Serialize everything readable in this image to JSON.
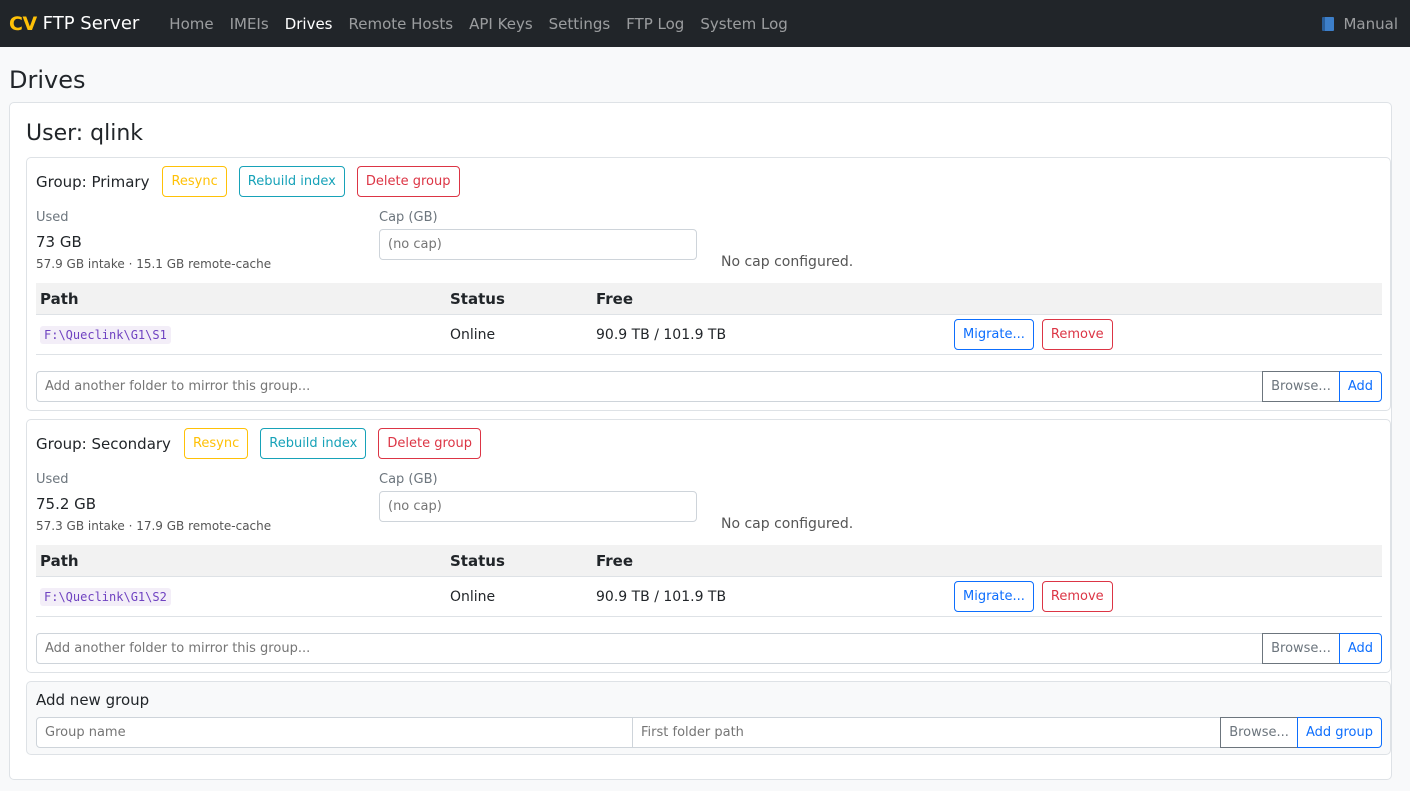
{
  "navbar": {
    "logo": "CV",
    "brand": "FTP Server",
    "links": [
      "Home",
      "IMEIs",
      "Drives",
      "Remote Hosts",
      "API Keys",
      "Settings",
      "FTP Log",
      "System Log"
    ],
    "active": "Drives",
    "manual": "Manual"
  },
  "page": {
    "title": "Drives"
  },
  "user": {
    "title": "User: qlink"
  },
  "groups": [
    {
      "title": "Group: Primary",
      "resync": "Resync",
      "rebuild": "Rebuild index",
      "delete": "Delete group",
      "used_label": "Used",
      "used_value": "73 GB",
      "used_detail": "57.9 GB intake · 15.1 GB remote-cache",
      "cap_label": "Cap (GB)",
      "cap_placeholder": "(no cap)",
      "cap_note": "No cap configured.",
      "headers": {
        "path": "Path",
        "status": "Status",
        "free": "Free"
      },
      "rows": [
        {
          "path": "F:\\Queclink\\G1\\S1",
          "status": "Online",
          "free": "90.9 TB / 101.9 TB",
          "migrate": "Migrate...",
          "remove": "Remove"
        }
      ],
      "add_placeholder": "Add another folder to mirror this group...",
      "browse": "Browse...",
      "add": "Add"
    },
    {
      "title": "Group: Secondary",
      "resync": "Resync",
      "rebuild": "Rebuild index",
      "delete": "Delete group",
      "used_label": "Used",
      "used_value": "75.2 GB",
      "used_detail": "57.3 GB intake · 17.9 GB remote-cache",
      "cap_label": "Cap (GB)",
      "cap_placeholder": "(no cap)",
      "cap_note": "No cap configured.",
      "headers": {
        "path": "Path",
        "status": "Status",
        "free": "Free"
      },
      "rows": [
        {
          "path": "F:\\Queclink\\G1\\S2",
          "status": "Online",
          "free": "90.9 TB / 101.9 TB",
          "migrate": "Migrate...",
          "remove": "Remove"
        }
      ],
      "add_placeholder": "Add another folder to mirror this group...",
      "browse": "Browse...",
      "add": "Add"
    }
  ],
  "new_group": {
    "title": "Add new group",
    "name_placeholder": "Group name",
    "path_placeholder": "First folder path",
    "browse": "Browse...",
    "add": "Add group"
  },
  "colors": {
    "navbar_bg": "#212529",
    "logo": "#ffc107",
    "warning": "#ffc107",
    "info": "#17a2b8",
    "danger": "#dc3545",
    "primary": "#0d6efd",
    "code": "#6f42c1"
  },
  "icons": {
    "manual": "book-icon"
  }
}
